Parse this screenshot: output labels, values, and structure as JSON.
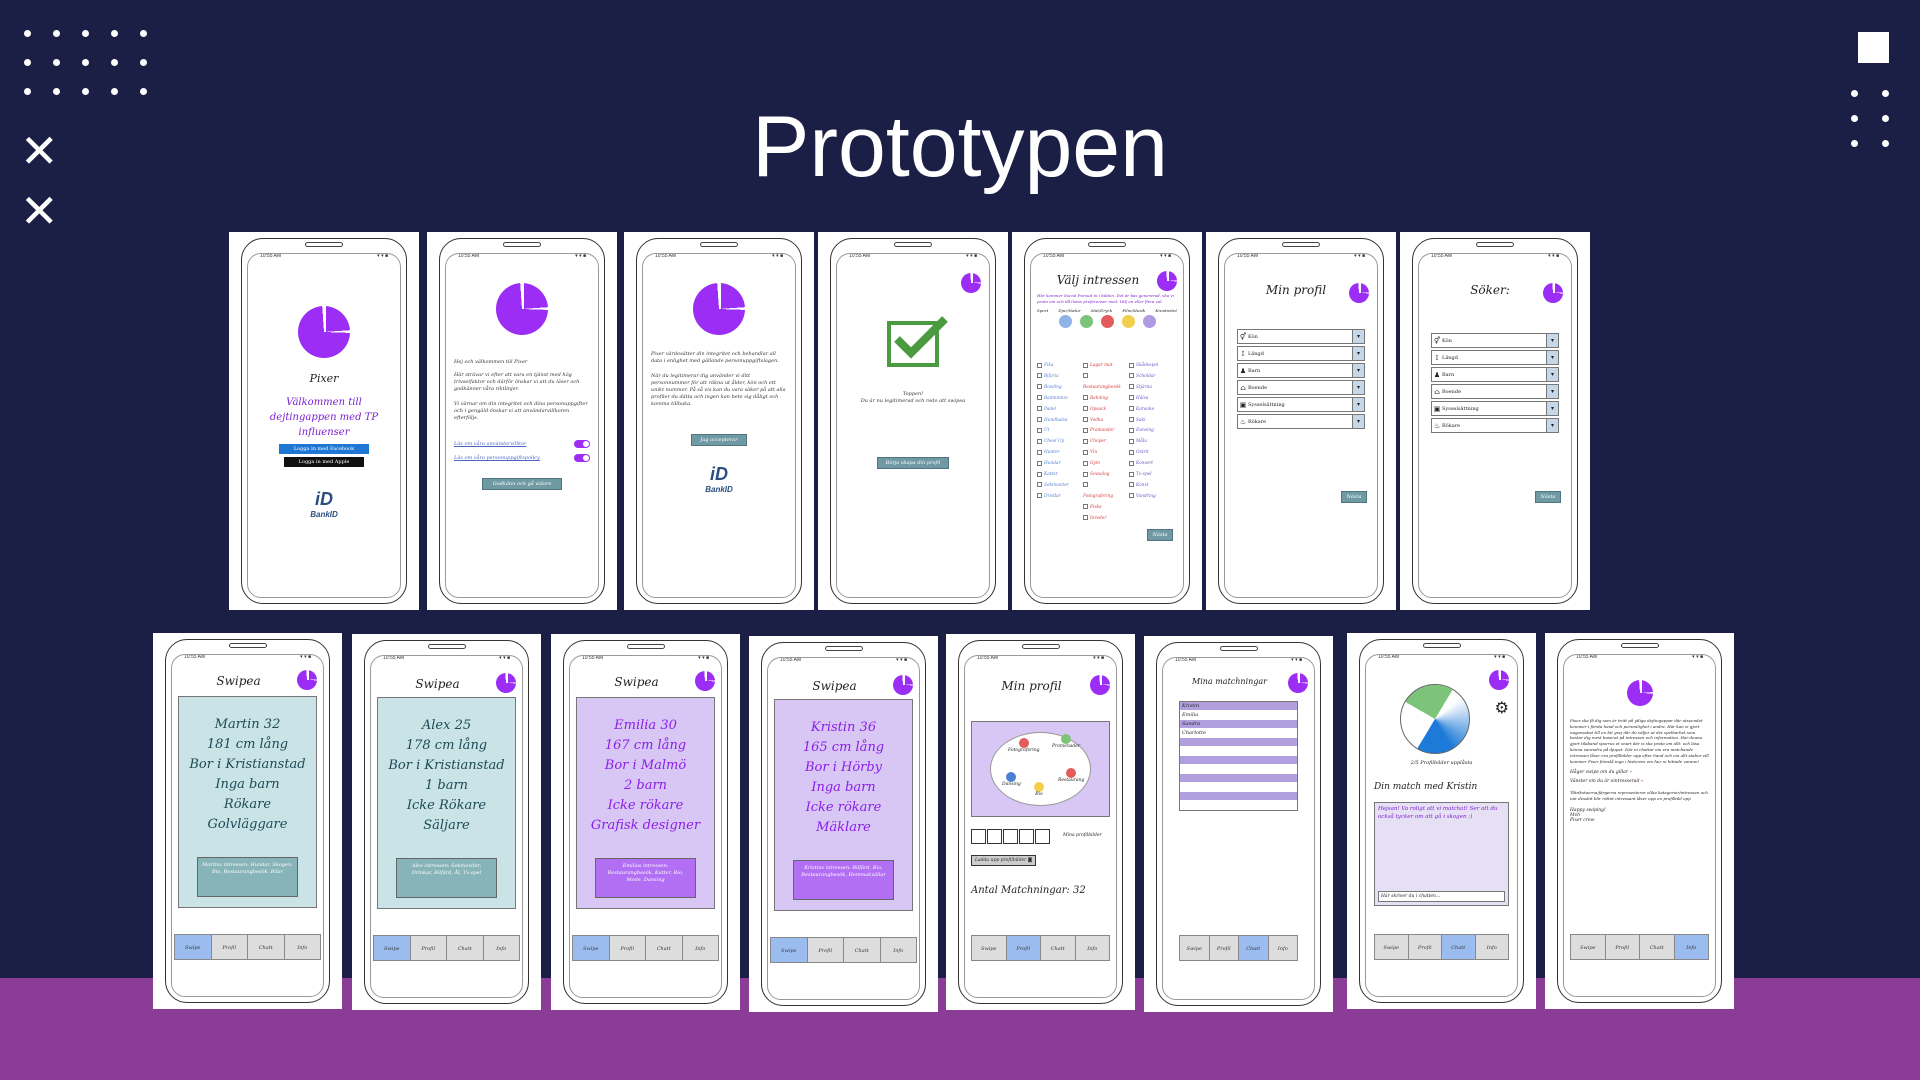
{
  "slide": {
    "title": "Prototypen"
  },
  "colors": {
    "background": "#1b1f45",
    "band": "#8a3c96",
    "accent": "#9b2df5",
    "nav_active": "#9bbcef",
    "button": "#6f9aa4"
  },
  "phone_status": {
    "time": "10:55 AM",
    "signal": "▾ ▾ ■"
  },
  "nav_labels": [
    "Swipe",
    "Profil",
    "Chatt",
    "Info"
  ],
  "screen_login": {
    "app_name": "Pixer",
    "welcome": "Välkommen till dejtingappen med TP influenser",
    "facebook": "Logga in med Facebook",
    "apple": "Logga in med Apple",
    "bankid": "BankID"
  },
  "screen_intro": {
    "greeting": "Hej och välkommen till Pixer",
    "p1": "Här strävar vi efter att vara en tjänst med hög trivselfaktor och därför önskar vi att du läser och godkänner våra riktlinjer.",
    "p2": "Vi värnar om din integritet och dina personuppgifter och i gengäld önskar vi att användarvillkoren efterföljs.",
    "terms_link": "Läs om våra användarvillkor",
    "privacy_link": "Läs om våra personuppgiftspolicy",
    "button": "Godkänn och gå vidare"
  },
  "screen_consent": {
    "p1": "Pixer värdesätter din integritet och behandlar all data i enlighet med gällande personuppgiftslagen.",
    "p2": "När du legitimerar dig använder vi ditt personnummer för att räkna ut ålder, kön och ett unikt nummer. På så vis kan du vara säker på att alla profiler du dätta och ingen kan bete sig dåligt och komma tillbaka.",
    "button": "Jag accepterar",
    "bankid": "BankID"
  },
  "screen_verified": {
    "text1": "Toppen!",
    "text2": "Du är nu legitimerad och redo att swipea",
    "button": "Börja skapa din profil"
  },
  "screen_interests": {
    "title": "Välj intressen",
    "intro": "Här kommer Social Pursuit in i bilden. Det är bas genererad, ska vi prata om och då listas preferenser med. Välj en eller flera val.",
    "categories": [
      "Sport",
      "Djur/Natur",
      "Mat/Dryck",
      "Film/Musik",
      "Kreativitet"
    ],
    "col1": [
      "Fika",
      "Bifaria",
      "Bowling",
      "Badminton",
      "Padel",
      "Hundhalsa",
      "Ut",
      "Cheel Up",
      "Hunter",
      "Hundar",
      "Katter",
      "Sekmoviter",
      "Dristlar"
    ],
    "col2": [
      "Lagar mat",
      "Restaurangbesök",
      "Bakning",
      "Opsack",
      "Vodka",
      "Pramander",
      "Choper",
      "Vin",
      "Gym",
      "Sovsalog",
      "Fotografering",
      "Fiske",
      "Inreder"
    ],
    "col3": [
      "Skådespel",
      "Scholdar",
      "Stjärna",
      "Hälsa",
      "Karaoke",
      "Saki",
      "Dansing",
      "Måla",
      "Ostrit",
      "Konsert",
      "Tv-spel",
      "Konst",
      "Vandring"
    ],
    "button": "Nästa"
  },
  "screen_myprofile_form": {
    "title": "Min profil",
    "rows": [
      "Kön",
      "Längd",
      "Barn",
      "Boende",
      "Sysselsättning",
      "Rökare"
    ],
    "button": "Nästa"
  },
  "screen_search_form": {
    "title": "Söker:",
    "rows": [
      "Kön",
      "Längd",
      "Barn",
      "Boende",
      "Sysselsättning",
      "Rökare"
    ],
    "button": "Nästa"
  },
  "swipe_screens": [
    {
      "title": "Swipea",
      "theme": "tealc",
      "lines": [
        "Martin 32",
        "181 cm lång",
        "Bor i Kristianstad",
        "Inga barn",
        "Rökare",
        "Golvläggare"
      ],
      "interests": "Martins intressen: Hundar, Skogen, Bio, Restaurangbesök, Bilar"
    },
    {
      "title": "Swipea",
      "theme": "tealc",
      "lines": [
        "Alex 25",
        "178 cm lång",
        "Bor i Kristianstad",
        "1 barn",
        "Icke Rökare",
        "Säljare"
      ],
      "interests": "Alex intressen: Sekmoviter, Drinkar, Bilfärd, Ål, Tv-spel"
    },
    {
      "title": "Swipea",
      "theme": "purpc",
      "lines": [
        "Emilia 30",
        "167 cm lång",
        "Bor i Malmö",
        "2 barn",
        "Icke rökare",
        "Grafisk designer"
      ],
      "interests": "Emilias intressen: Restaurangbesök, Katter, Bio, Mode, Dansing"
    },
    {
      "title": "Swipea",
      "theme": "purpc",
      "lines": [
        "Kristin 36",
        "165 cm lång",
        "Bor i Hörby",
        "Inga barn",
        "Icke rökare",
        "Mäklare"
      ],
      "interests": "Kristins intressen: Bilfärd, Bio, Restaurangbesök, Hemmakvällar"
    }
  ],
  "screen_profile_view": {
    "title": "Min profil",
    "bubbles": [
      "Fotografering",
      "Promenader",
      "Dansing",
      "Bio",
      "Restaurang"
    ],
    "more_label": "Mina profilbilder",
    "upload": "Ladda upp profilbilder",
    "matches": "Antal Matchningar: 32"
  },
  "screen_matches": {
    "title": "Mina matchningar",
    "names": [
      "Kristin",
      "Emilia",
      "Sandra",
      "Charlotte"
    ]
  },
  "screen_chat": {
    "unlocked": "2/5 Profilbilder upplåsta",
    "match_title": "Din match med Kristin",
    "message": "Hejsan! Va roligt att vi matchat! Ser att du också tycker om att gå i skogen :)",
    "input_placeholder": "Här skriver du i chatten..."
  },
  "screen_info": {
    "p1": "Pixer ska få dig som är trött på ytliga dejtingappar där utseendet kommer i första hand och personlighet i andra. Här kan vi gjort nagonsabst till en bit grej där du väljer ut det spelbarhet som bestar dig mest baserat på intressen och information. Har deuna gjort tilaband spurrus et snart där vi ska prata om allt: och läsa könna varandra på djupet. När ni chattar om era matchande intressen låser era profilbilder upp efter hand och om allt stabor vill kommer Pixer föreslå inga i historien om hur ni hittade varann!",
    "like": "Håger swipe om du gillar",
    "dislike": "Vänster om du är ointresserad",
    "p2": "Tåtrikstaerna/färgerna representerar olika kategorier/intressen och när dessbit blir röttnt intressant låser upp en profilbild opp",
    "sign1": "Happy swiping!",
    "sign2": "Mvh",
    "sign3": "Pixer crew"
  }
}
